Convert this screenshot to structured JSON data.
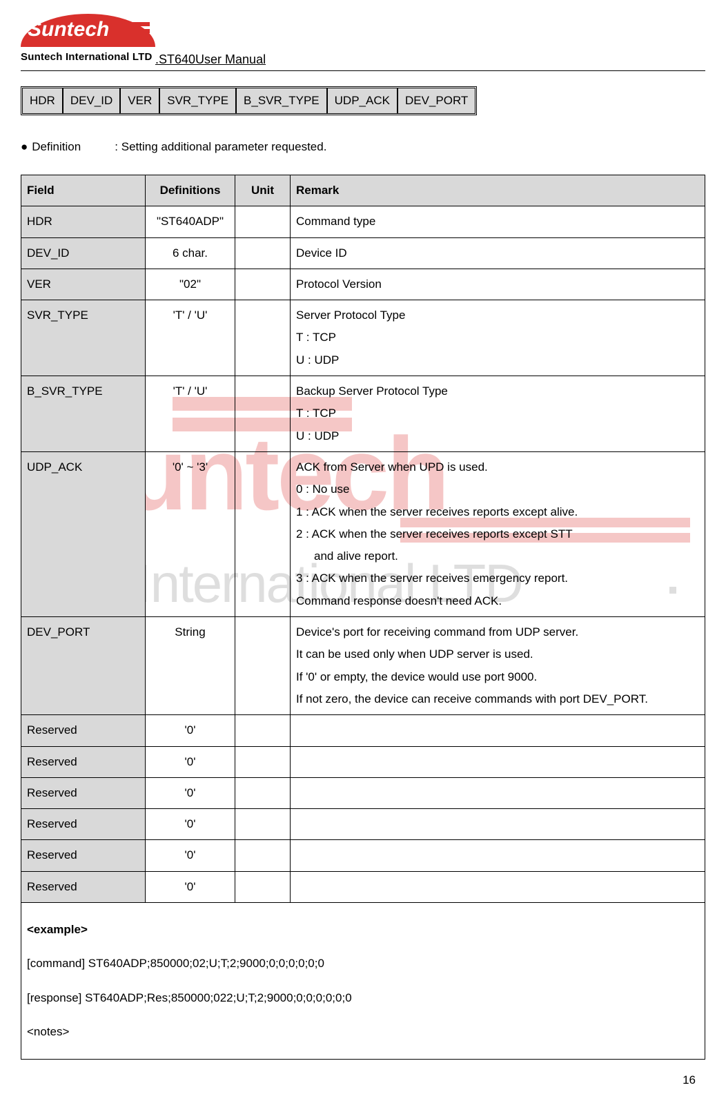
{
  "header": {
    "logo_top": "Suntech",
    "logo_bottom": "Suntech International LTD",
    "doc_title": ".ST640User Manual"
  },
  "pills": [
    "HDR",
    "DEV_ID",
    "VER",
    "SVR_TYPE",
    "B_SVR_TYPE",
    "UDP_ACK",
    "DEV_PORT"
  ],
  "definition_line": {
    "bullet": "●",
    "label": "Definition",
    "sep": ":",
    "text": "Setting additional parameter requested."
  },
  "table": {
    "headers": {
      "field": "Field",
      "def": "Definitions",
      "unit": "Unit",
      "remark": "Remark"
    },
    "rows": [
      {
        "field": "HDR",
        "def": "\"ST640ADP\"",
        "unit": "",
        "remark": [
          "Command type"
        ]
      },
      {
        "field": "DEV_ID",
        "def": "6 char.",
        "unit": "",
        "remark": [
          "Device ID"
        ]
      },
      {
        "field": "VER",
        "def": "\"02\"",
        "unit": "",
        "remark": [
          "Protocol Version"
        ]
      },
      {
        "field": "SVR_TYPE",
        "def": "'T' / 'U'",
        "unit": "",
        "remark": [
          "Server Protocol Type",
          "T : TCP",
          "U : UDP"
        ]
      },
      {
        "field": "B_SVR_TYPE",
        "def": "'T' / 'U'",
        "unit": "",
        "remark": [
          "Backup Server Protocol Type",
          "T : TCP",
          "U : UDP"
        ]
      },
      {
        "field": "UDP_ACK",
        "def": "'0' ~ '3'",
        "unit": "",
        "remark": [
          "ACK from Server when UPD is used.",
          "0 : No use",
          "1 : ACK when the server receives reports except alive.",
          "2 : ACK when the server receives reports except STT",
          "    and alive report.",
          "3 : ACK when the server receives emergency report.",
          "Command response doesn't need ACK."
        ]
      },
      {
        "field": "DEV_PORT",
        "def": "String",
        "unit": "",
        "remark": [
          "Device's port for receiving command from UDP server.",
          "It can be used only when UDP server is used.",
          "If '0' or empty, the device would use port 9000.",
          "If not zero, the device can receive commands with port DEV_PORT."
        ],
        "justify_last": true
      },
      {
        "field": "Reserved",
        "def": "'0'",
        "unit": "",
        "remark": [
          ""
        ]
      },
      {
        "field": "Reserved",
        "def": "'0'",
        "unit": "",
        "remark": [
          ""
        ]
      },
      {
        "field": "Reserved",
        "def": "'0'",
        "unit": "",
        "remark": [
          ""
        ]
      },
      {
        "field": "Reserved",
        "def": "'0'",
        "unit": "",
        "remark": [
          ""
        ]
      },
      {
        "field": "Reserved",
        "def": "'0'",
        "unit": "",
        "remark": [
          ""
        ]
      },
      {
        "field": "Reserved",
        "def": "'0'",
        "unit": "",
        "remark": [
          ""
        ]
      }
    ],
    "example": {
      "title": "<example>",
      "lines": [
        "[command] ST640ADP;850000;02;U;T;2;9000;0;0;0;0;0;0",
        "[response]  ST640ADP;Res;850000;022;U;T;2;9000;0;0;0;0;0;0",
        "<notes>"
      ]
    }
  },
  "watermark": {
    "big": "untech",
    "gray": "ch International LTD"
  },
  "page_number": "16"
}
